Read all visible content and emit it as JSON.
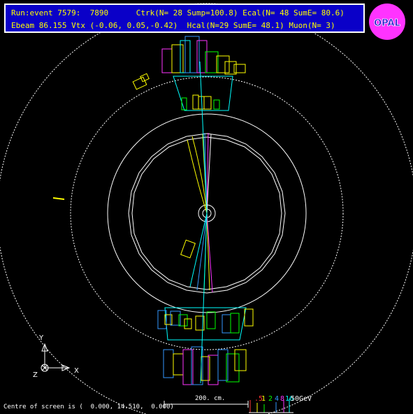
{
  "header": {
    "line1": "Run:event 7579:  7890      Ctrk(N= 28 Sump=100.8) Ecal(N= 48 SumE= 80.6)",
    "line2": "Ebeam 86.155 Vtx (-0.06, 0.05,-0.42)  Hcal(N=29 SumE= 48.1) Muon(N= 3)"
  },
  "logo": {
    "text": "OPAL"
  },
  "footer": {
    "centre_text": "Centre of screen is (  0.000, 14.510,  0.000)"
  },
  "scale": {
    "label": "200. cm."
  },
  "legend": {
    "items": [
      {
        "text": ".5",
        "color": "#ff3333"
      },
      {
        "text": "1",
        "color": "#ffff00"
      },
      {
        "text": "2",
        "color": "#00ff00"
      },
      {
        "text": "4",
        "color": "#3399ff"
      },
      {
        "text": "8",
        "color": "#ff33ff"
      },
      {
        "text": "16",
        "color": "#00ffff"
      },
      {
        "text": "50",
        "color": "#ffffff"
      },
      {
        "text": "GeV",
        "color": "#ffffff"
      }
    ]
  },
  "axes": {
    "y": "Y",
    "x": "X",
    "z": "Z"
  },
  "colors": {
    "track_yellow": "#ffff00",
    "track_green": "#00ff00",
    "track_magenta": "#ff33ff",
    "track_blue": "#3399ff",
    "cyan": "#00ffff",
    "white": "#ffffff",
    "header_bg": "#0a00c8"
  }
}
